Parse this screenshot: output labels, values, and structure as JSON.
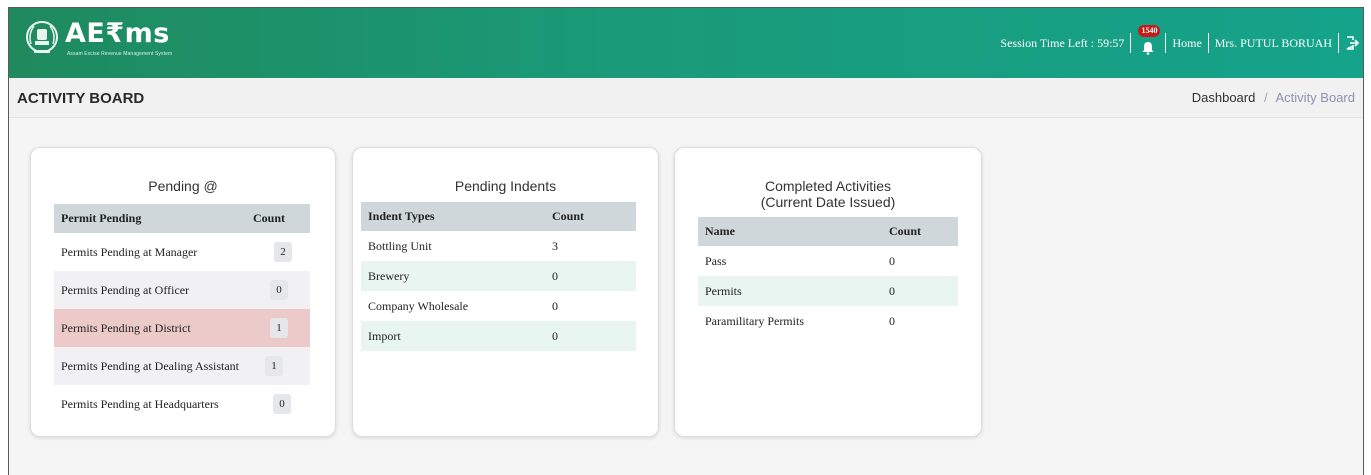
{
  "header": {
    "logo_text": "AE₹ms",
    "logo_sub": "Assam Excise Revenue Management System",
    "session_label": "Session Time Left : 59:57",
    "notification_count": "1540",
    "home_label": "Home",
    "user_name": "Mrs. PUTUL BORUAH"
  },
  "titlebar": {
    "title": "ACTIVITY BOARD",
    "breadcrumb": {
      "home": "Dashboard",
      "separator": "/",
      "current": "Activity Board"
    }
  },
  "pending": {
    "title": "Pending @",
    "headers": [
      "Permit Pending",
      "Count"
    ],
    "rows": [
      {
        "label": "Permits Pending at Manager",
        "count": "2"
      },
      {
        "label": "Permits Pending at Officer",
        "count": "0"
      },
      {
        "label": "Permits Pending at District",
        "count": "1"
      },
      {
        "label": "Permits Pending at Dealing Assistant",
        "count": "1"
      },
      {
        "label": "Permits Pending at Headquarters",
        "count": "0"
      }
    ]
  },
  "indents": {
    "title": "Pending Indents",
    "headers": [
      "Indent Types",
      "Count"
    ],
    "rows": [
      {
        "label": "Bottling Unit",
        "count": "3"
      },
      {
        "label": "Brewery",
        "count": "0"
      },
      {
        "label": "Company Wholesale",
        "count": "0"
      },
      {
        "label": "Import",
        "count": "0"
      }
    ]
  },
  "completed": {
    "title_line1": "Completed Activities",
    "title_line2": "(Current Date Issued)",
    "headers": [
      "Name",
      "Count"
    ],
    "rows": [
      {
        "label": "Pass",
        "count": "0"
      },
      {
        "label": "Permits",
        "count": "0"
      },
      {
        "label": "Paramilitary Permits",
        "count": "0"
      }
    ]
  },
  "colors": {
    "header_start": "#1f8a5e",
    "header_end": "#15a38b",
    "table_header": "#cfd7da",
    "highlight_row": "#eccaca",
    "alt_row": "#e9f5f1",
    "badge": "#c51b1b"
  },
  "icons": [
    "state-emblem-icon",
    "bell-icon",
    "logout-icon"
  ]
}
